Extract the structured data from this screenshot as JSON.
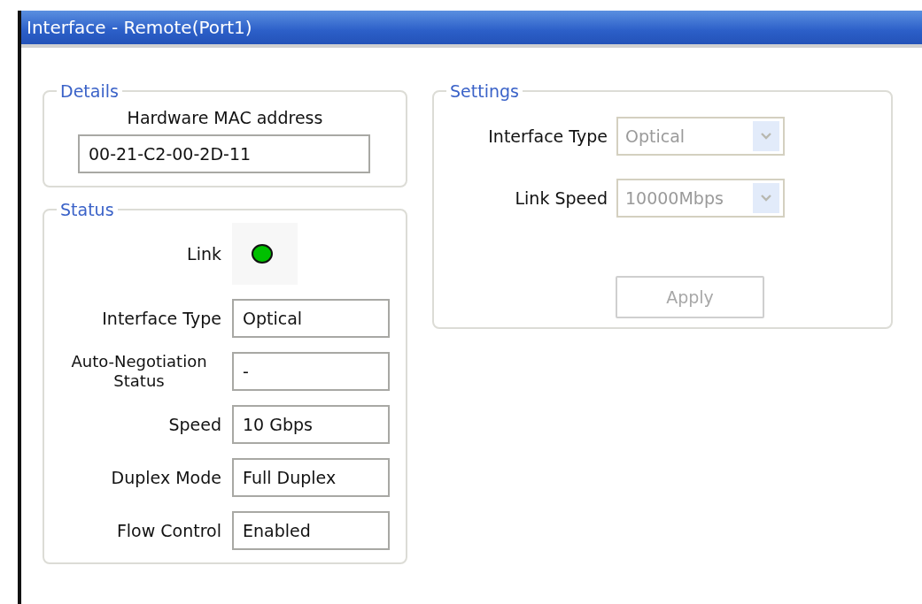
{
  "window": {
    "title": "Interface - Remote(Port1)"
  },
  "details": {
    "legend": "Details",
    "mac_label": "Hardware MAC address",
    "mac_value": "00-21-C2-00-2D-11"
  },
  "status": {
    "legend": "Status",
    "link": {
      "label": "Link",
      "on": true
    },
    "rows": [
      {
        "label": "Interface Type",
        "value": "Optical"
      },
      {
        "label": "Auto-Negotiation Status",
        "value": "-"
      },
      {
        "label": "Speed",
        "value": "10 Gbps"
      },
      {
        "label": "Duplex Mode",
        "value": "Full Duplex"
      },
      {
        "label": "Flow Control",
        "value": "Enabled"
      }
    ]
  },
  "settings": {
    "legend": "Settings",
    "fields": [
      {
        "label": "Interface Type",
        "value": "Optical",
        "disabled": true
      },
      {
        "label": "Link Speed",
        "value": "10000Mbps",
        "disabled": true
      }
    ],
    "apply": {
      "label": "Apply",
      "disabled": true
    }
  }
}
